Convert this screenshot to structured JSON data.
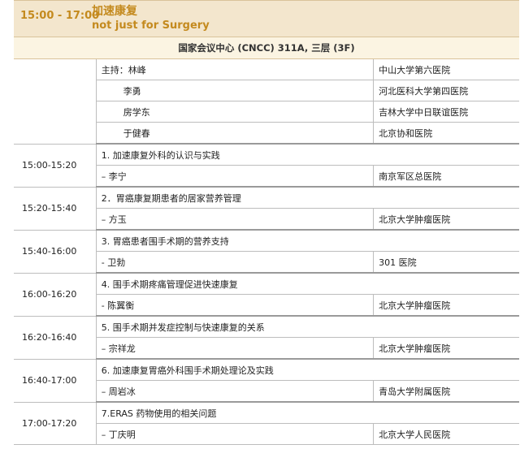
{
  "header": {
    "time": "15:00 - 17:00",
    "title_cn": "加速康复",
    "title_en": "not just for Surgery"
  },
  "venue": "国家会议中心 (CNCC)  311A, 三层 (3F)",
  "moderators": [
    {
      "name": "主持：林峰",
      "org": "中山大学第六医院"
    },
    {
      "name": "李勇",
      "org": "河北医科大学第四医院"
    },
    {
      "name": "房学东",
      "org": "吉林大学中日联谊医院"
    },
    {
      "name": "于健春",
      "org": "北京协和医院"
    }
  ],
  "sessions": [
    {
      "time": "15:00-15:20",
      "topic": "1. 加速康复外科的认识与实践",
      "speaker": "– 李宁",
      "org": "南京军区总医院"
    },
    {
      "time": "15:20-15:40",
      "topic": "2．胃癌康复期患者的居家营养管理",
      "speaker": "– 方玉",
      "org": "北京大学肿瘤医院"
    },
    {
      "time": "15:40-16:00",
      "topic": "3. 胃癌患者围手术期的营养支持",
      "speaker": "- 卫勃",
      "org": "301 医院"
    },
    {
      "time": "16:00-16:20",
      "topic": "4. 围手术期疼痛管理促进快速康复",
      "speaker": "- 陈翼衡",
      "org": "北京大学肿瘤医院"
    },
    {
      "time": "16:20-16:40",
      "topic": "5. 围手术期并发症控制与快速康复的关系",
      "speaker": "– 宗祥龙",
      "org": "北京大学肿瘤医院"
    },
    {
      "time": "16:40-17:00",
      "topic": "6. 加速康复胃癌外科围手术期处理论及实践",
      "speaker": "– 周岩冰",
      "org": "青岛大学附属医院"
    },
    {
      "time": "17:00-17:20",
      "topic": "7.ERAS 药物使用的相关问题",
      "speaker": "– 丁庆明",
      "org": "北京大学人民医院"
    }
  ]
}
